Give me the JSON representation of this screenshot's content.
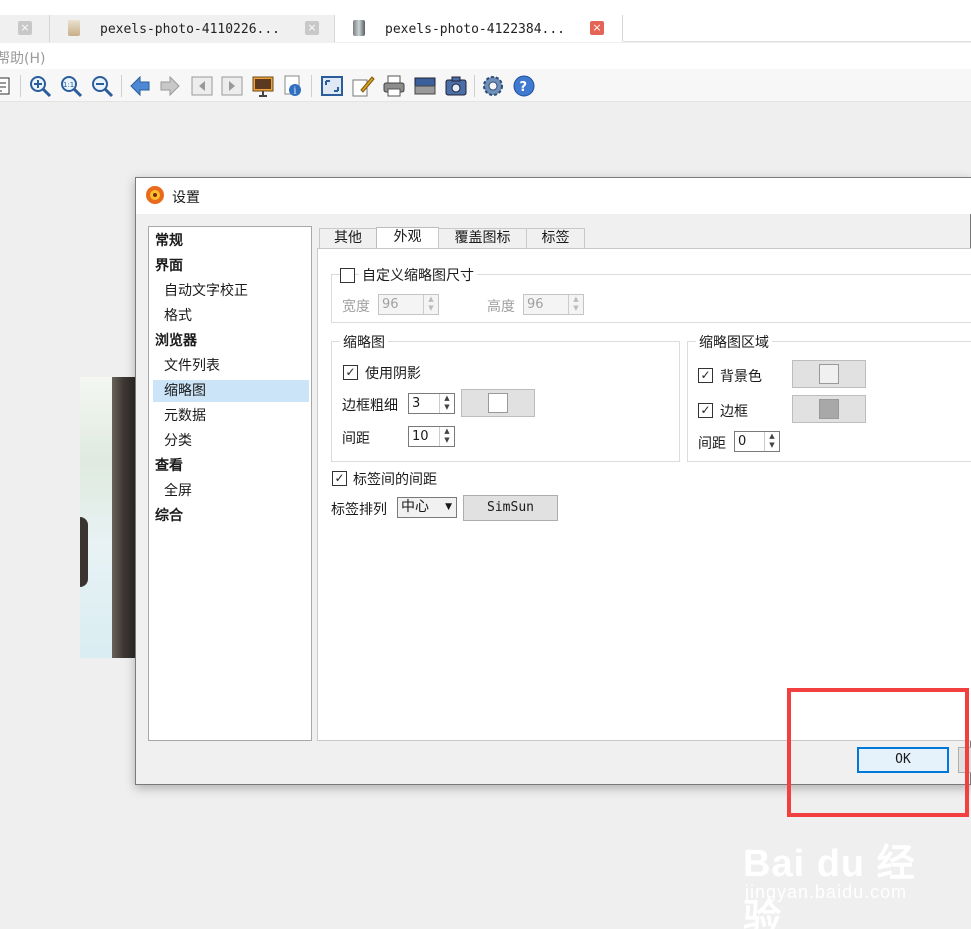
{
  "browser_tabs": [
    {
      "title": "",
      "close_icon": "close-icon"
    },
    {
      "title": "pexels-photo-4110226...",
      "close_icon": "close-icon"
    },
    {
      "title": "pexels-photo-4122384...",
      "close_icon": "close-icon",
      "active": true
    }
  ],
  "menu": {
    "help": "帮助(H)"
  },
  "toolbar": {
    "icons": [
      "edit-icon",
      "zoom-in-icon",
      "zoom-actual-icon",
      "zoom-out-icon",
      "prev-icon",
      "next-icon",
      "first-icon",
      "last-icon",
      "slideshow-icon",
      "info-icon",
      "fit-window-icon",
      "draw-icon",
      "print-icon",
      "scanner-icon",
      "camera-icon",
      "settings-gear-icon",
      "help-icon"
    ]
  },
  "dialog": {
    "title": "设置",
    "nav": [
      {
        "label": "常规",
        "level": 0
      },
      {
        "label": "界面",
        "level": 0
      },
      {
        "label": "自动文字校正",
        "level": 1
      },
      {
        "label": "格式",
        "level": 1
      },
      {
        "label": "浏览器",
        "level": 0
      },
      {
        "label": "文件列表",
        "level": 1
      },
      {
        "label": "缩略图",
        "level": 1,
        "selected": true
      },
      {
        "label": "元数据",
        "level": 1
      },
      {
        "label": "分类",
        "level": 1
      },
      {
        "label": "查看",
        "level": 0
      },
      {
        "label": "全屏",
        "level": 1
      },
      {
        "label": "综合",
        "level": 0
      }
    ],
    "tabs": [
      "其他",
      "外观",
      "覆盖图标",
      "标签"
    ],
    "active_tab": "外观",
    "custom_size": {
      "label": "自定义缩略图尺寸",
      "checked": false,
      "width_label": "宽度",
      "width_value": "96",
      "height_label": "高度",
      "height_value": "96"
    },
    "thumbnail_group": {
      "title": "缩略图",
      "shadow_label": "使用阴影",
      "shadow_checked": true,
      "border_width_label": "边框粗细",
      "border_width_value": "3",
      "border_color": "#ffffff",
      "spacing_label": "间距",
      "spacing_value": "10"
    },
    "area_group": {
      "title": "缩略图区域",
      "bg_label": "背景色",
      "bg_checked": true,
      "bg_color": "#f0f0f0",
      "border_label": "边框",
      "border_checked": true,
      "border_color": "#a8a8a8",
      "spacing_label": "间距",
      "spacing_value": "0"
    },
    "label_spacing": {
      "label": "标签间的间距",
      "checked": true
    },
    "label_align": {
      "label": "标签排列",
      "value": "中心",
      "font_button": "SimSun"
    },
    "ok_label": "OK"
  },
  "watermark": {
    "logo": "Bai du 经验",
    "url": "jingyan.baidu.com"
  },
  "colors": {
    "highlight": "#f23f3f",
    "selection": "#cce4f7",
    "ok_border": "#0078d7"
  }
}
